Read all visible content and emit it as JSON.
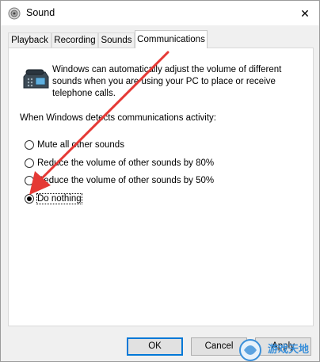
{
  "window": {
    "title": "Sound",
    "close_glyph": "✕"
  },
  "tabs": [
    {
      "label": "Playback",
      "active": false
    },
    {
      "label": "Recording",
      "active": false
    },
    {
      "label": "Sounds",
      "active": false
    },
    {
      "label": "Communications",
      "active": true
    }
  ],
  "communications": {
    "description": "Windows can automatically adjust the volume of different sounds when you are using your PC to place or receive telephone calls.",
    "detect_label": "When Windows detects communications activity:",
    "options": [
      {
        "label": "Mute all other sounds",
        "checked": false
      },
      {
        "label": "Reduce the volume of other sounds by 80%",
        "checked": false
      },
      {
        "label": "Reduce the volume of other sounds by 50%",
        "checked": false
      },
      {
        "label": "Do nothing",
        "checked": true
      }
    ]
  },
  "buttons": {
    "ok": "OK",
    "cancel": "Cancel",
    "apply": "Apply"
  },
  "annotation": {
    "arrow_color": "#e53935"
  },
  "watermark": {
    "text": "游戏天地"
  },
  "colors": {
    "accent": "#0078d7",
    "arrow": "#e53935"
  },
  "icons": {
    "title": "speaker-icon",
    "close": "close-icon",
    "panel": "telephone-icon",
    "watermark": "watermark-logo-icon"
  }
}
